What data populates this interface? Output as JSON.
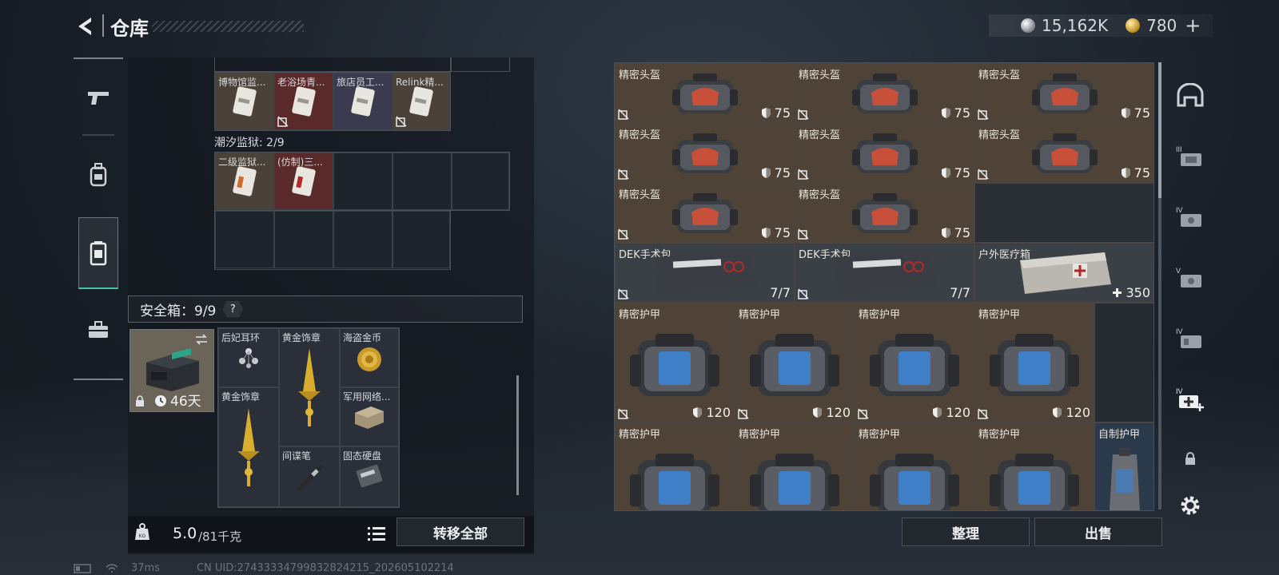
{
  "header": {
    "title": "仓库"
  },
  "currency": {
    "primary": "15,162K",
    "secondary": "780"
  },
  "nav": {
    "items": [
      "weapons",
      "backpack",
      "vest",
      "toolbox"
    ],
    "active": 2
  },
  "stash": {
    "row1": [
      "博物馆监...",
      "老浴场青...",
      "旅店员工...",
      "Relink精..."
    ],
    "section_label": "潮汐监狱: 2/9",
    "row2": [
      "二级监狱...",
      "(仿制)三..."
    ]
  },
  "safe": {
    "label": "安全箱：9/9",
    "help": "?",
    "days": "46天",
    "items": [
      "后妃耳环",
      "黄金饰章",
      "海盗金币",
      "黄金饰章",
      "军用网络...",
      "间谍笔",
      "固态硬盘"
    ]
  },
  "weight": {
    "current": "5.0",
    "max": "/81千克"
  },
  "buttons": {
    "transfer_all": "转移全部",
    "organize": "整理",
    "sell": "出售"
  },
  "inventory": {
    "helmet_name": "精密头盔",
    "helmet_value": "75",
    "dek_name": "DEK手术包",
    "dek_value": "7/7",
    "outdoor_name": "户外医疗箱",
    "outdoor_value": "350",
    "armor_name": "精密护甲",
    "armor_value": "120",
    "custom_armor_name": "自制护甲"
  },
  "status": {
    "ping": "37ms",
    "uid": "CN UID:27433334799832824215_202605102214"
  },
  "colors": {
    "accent": "#3fc8a4",
    "tan": "#4e4336"
  }
}
